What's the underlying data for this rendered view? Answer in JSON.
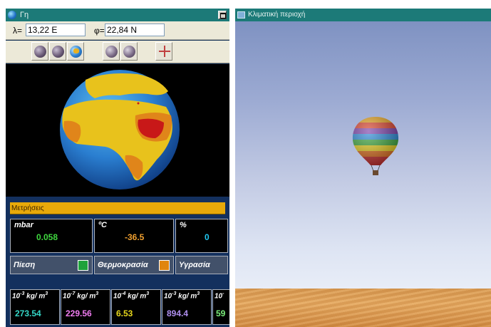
{
  "left_window": {
    "title": "Γη"
  },
  "coords": {
    "lambda_label": "λ=",
    "lambda_value": "13,22 E",
    "phi_label": "φ=",
    "phi_value": "22,84 N"
  },
  "toolbar": {
    "buttons": [
      "moon-ball-icon",
      "moon-ball-icon",
      "globe-icon",
      "moon-half-icon",
      "moon-half-icon",
      "compass-cross-icon"
    ]
  },
  "measurements": {
    "header": "Μετρήσεις",
    "pressure": {
      "unit": "mbar",
      "value": "0.058",
      "color": "#3fd83f"
    },
    "temperature": {
      "unit": "ºC",
      "value": "-36.5",
      "color": "#f0a030"
    },
    "humidity": {
      "unit": "%",
      "value": "0",
      "color": "#20c8f0"
    },
    "labels": {
      "pressure": "Πίεση",
      "temperature": "Θερμοκρασία",
      "humidity": "Υγρασία"
    },
    "swatches": {
      "pressure": "#1fa23c",
      "temperature": "#e0850e"
    }
  },
  "densities": [
    {
      "unit_base": "10",
      "unit_exp": "-3",
      "unit_rest": " kg/ m",
      "unit_exp2": "3",
      "value": "273.54",
      "color": "#35d8c8"
    },
    {
      "unit_base": "10",
      "unit_exp": "-7",
      "unit_rest": " kg/ m",
      "unit_exp2": "3",
      "value": "229.56",
      "color": "#f07cf0"
    },
    {
      "unit_base": "10",
      "unit_exp": "-4",
      "unit_rest": " kg/ m",
      "unit_exp2": "3",
      "value": "6.53",
      "color": "#e8d81c"
    },
    {
      "unit_base": "10",
      "unit_exp": "-3",
      "unit_rest": " kg/ m",
      "unit_exp2": "3",
      "value": "894.4",
      "color": "#b090f0"
    },
    {
      "unit_base": "10",
      "unit_exp": "-",
      "unit_rest": "",
      "unit_exp2": "",
      "value": "59",
      "color": "#7cf07c"
    }
  ],
  "right_window": {
    "title": "Κλιματική περιοχή"
  }
}
